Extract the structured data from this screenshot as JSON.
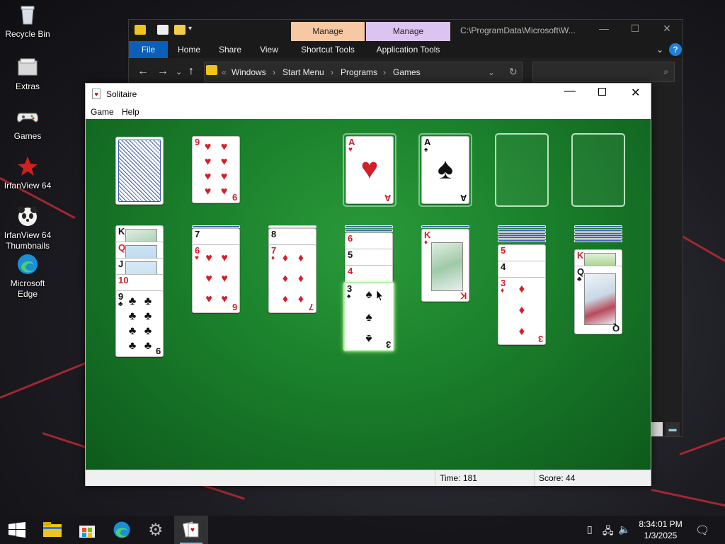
{
  "desktop": {
    "icons": [
      {
        "label": "Recycle Bin",
        "icon": "recycle-bin-icon"
      },
      {
        "label": "Extras",
        "icon": "folder-icon"
      },
      {
        "label": "Games",
        "icon": "gamepad-icon"
      },
      {
        "label": "IrfanView 64",
        "icon": "irfanview-icon"
      },
      {
        "label": "IrfanView 64 Thumbnails",
        "icon": "panda-icon"
      },
      {
        "label": "Microsoft Edge",
        "icon": "edge-icon"
      }
    ]
  },
  "explorer": {
    "title_path": "C:\\ProgramData\\Microsoft\\W...",
    "context_tabs": [
      {
        "label": "Manage",
        "color": "#f7c8a4"
      },
      {
        "label": "Manage",
        "color": "#dcc4f0"
      }
    ],
    "ribbon_tabs": [
      "File",
      "Home",
      "Share",
      "View",
      "Shortcut Tools",
      "Application Tools"
    ],
    "breadcrumb": [
      "Windows",
      "Start Menu",
      "Programs",
      "Games"
    ],
    "accent": "#0a60b8"
  },
  "solitaire": {
    "title": "Solitaire",
    "menu": [
      "Game",
      "Help"
    ],
    "status": {
      "time_label": "Time:",
      "time": "181",
      "score_label": "Score:",
      "score": "44"
    },
    "felt_color": "#1a7f2b",
    "cards": {
      "waste": {
        "rank": "9",
        "suit": "♥"
      },
      "foundation1": {
        "rank": "A",
        "suit": "♥"
      },
      "foundation2": {
        "rank": "A",
        "suit": "♠"
      },
      "col1": [
        {
          "rank": "K",
          "suit": "♦"
        },
        {
          "rank": "Q",
          "suit": "♦"
        },
        {
          "rank": "J",
          "suit": "♦"
        },
        {
          "rank": "10",
          "suit": "♥"
        },
        {
          "rank": "9",
          "suit": "♣"
        }
      ],
      "col2": [
        {
          "rank": "7",
          "suit": "♣"
        },
        {
          "rank": "6",
          "suit": "♥"
        }
      ],
      "col3": [
        {
          "rank": "8",
          "suit": "♠"
        },
        {
          "rank": "7",
          "suit": "♦"
        }
      ],
      "col4": [
        {
          "rank": "6",
          "suit": "♦"
        },
        {
          "rank": "5",
          "suit": "♣"
        },
        {
          "rank": "4",
          "suit": "♥"
        },
        {
          "rank": "3",
          "suit": "♠"
        }
      ],
      "col5": [
        {
          "rank": "K",
          "suit": "♦"
        }
      ],
      "col6": [
        {
          "rank": "5",
          "suit": "♥"
        },
        {
          "rank": "4",
          "suit": "♣"
        },
        {
          "rank": "3",
          "suit": "♦"
        }
      ],
      "col7": [
        {
          "rank": "K",
          "suit": "♣"
        },
        {
          "rank": "Q",
          "suit": "♣"
        }
      ]
    }
  },
  "taskbar": {
    "clock_time": "8:34:01 PM",
    "clock_date": "1/3/2025",
    "apps": [
      "start-icon",
      "file-explorer-icon",
      "store-icon",
      "edge-icon",
      "settings-gear-icon",
      "solitaire-icon"
    ]
  }
}
